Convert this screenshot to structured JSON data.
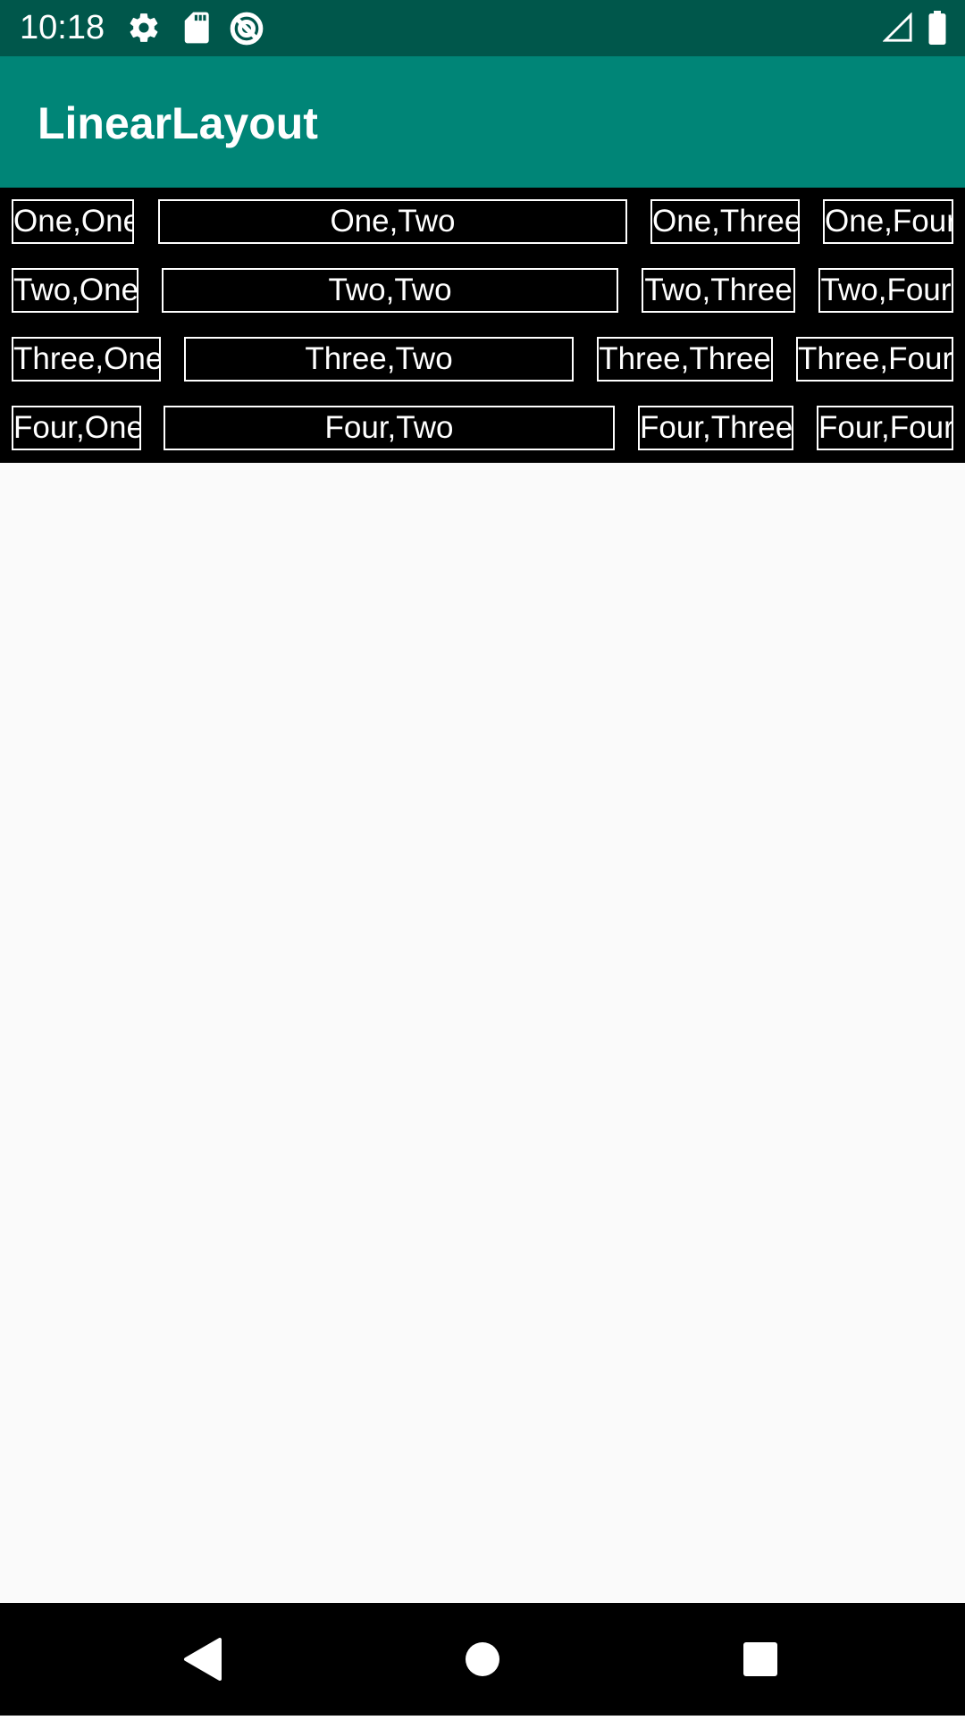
{
  "status_bar": {
    "time": "10:18",
    "icons": [
      "gear-icon",
      "sd-card-icon",
      "sync-icon",
      "signal-icon",
      "battery-icon"
    ]
  },
  "app_bar": {
    "title": "LinearLayout"
  },
  "grid": {
    "rows": [
      [
        "One,One",
        "One,Two",
        "One,Three",
        "One,Four"
      ],
      [
        "Two,One",
        "Two,Two",
        "Two,Three",
        "Two,Four"
      ],
      [
        "Three,One",
        "Three,Two",
        "Three,Three",
        "Three,Four"
      ],
      [
        "Four,One",
        "Four,Two",
        "Four,Three",
        "Four,Four"
      ]
    ]
  },
  "nav_bar": {
    "icons": [
      "back-icon",
      "home-icon",
      "recents-icon"
    ]
  },
  "colors": {
    "status_bar": "#00574b",
    "app_bar": "#008577",
    "grid_background": "#000000",
    "cell_border": "#ffffff",
    "content_background": "#fafafa"
  }
}
